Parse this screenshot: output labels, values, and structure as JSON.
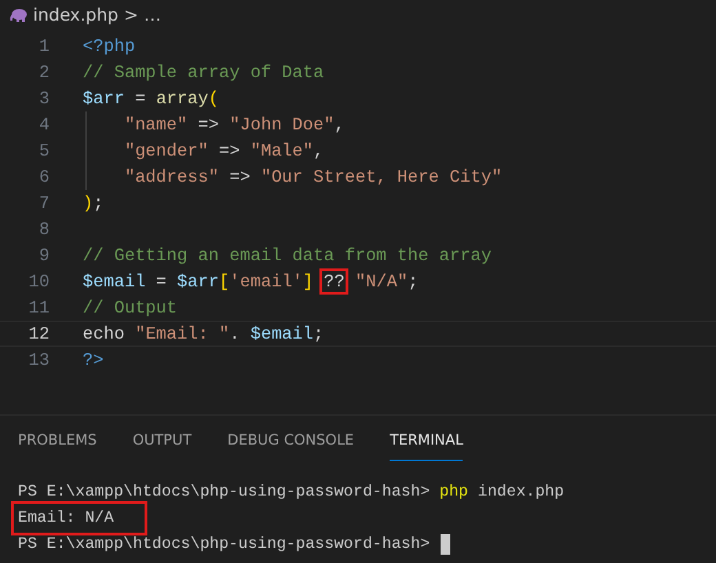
{
  "breadcrumb": {
    "items": [
      "index.php",
      "…"
    ],
    "separator": ">"
  },
  "code_lines": [
    {
      "number": "1",
      "active": false,
      "tokens": [
        {
          "kind": "keyword",
          "text": "<?php"
        }
      ]
    },
    {
      "number": "2",
      "active": false,
      "tokens": [
        {
          "kind": "comment",
          "text": "// Sample array of Data"
        }
      ]
    },
    {
      "number": "3",
      "active": false,
      "tokens": [
        {
          "kind": "variable",
          "text": "$arr"
        },
        {
          "kind": "plain",
          "text": " = "
        },
        {
          "kind": "function",
          "text": "array"
        },
        {
          "kind": "bracket",
          "text": "("
        }
      ]
    },
    {
      "number": "4",
      "active": false,
      "indented": true,
      "tokens": [
        {
          "kind": "string",
          "text": "\"name\""
        },
        {
          "kind": "plain",
          "text": " => "
        },
        {
          "kind": "string",
          "text": "\"John Doe\""
        },
        {
          "kind": "plain",
          "text": ","
        }
      ]
    },
    {
      "number": "5",
      "active": false,
      "indented": true,
      "tokens": [
        {
          "kind": "string",
          "text": "\"gender\""
        },
        {
          "kind": "plain",
          "text": " => "
        },
        {
          "kind": "string",
          "text": "\"Male\""
        },
        {
          "kind": "plain",
          "text": ","
        }
      ]
    },
    {
      "number": "6",
      "active": false,
      "indented": true,
      "tokens": [
        {
          "kind": "string",
          "text": "\"address\""
        },
        {
          "kind": "plain",
          "text": " => "
        },
        {
          "kind": "string",
          "text": "\"Our Street, Here City\""
        }
      ]
    },
    {
      "number": "7",
      "active": false,
      "tokens": [
        {
          "kind": "bracket",
          "text": ")"
        },
        {
          "kind": "plain",
          "text": ";"
        }
      ]
    },
    {
      "number": "8",
      "active": false
    },
    {
      "number": "9",
      "active": false,
      "tokens": [
        {
          "kind": "comment",
          "text": "// Getting an email data from the array"
        }
      ]
    },
    {
      "number": "10",
      "active": false,
      "tokens": [
        {
          "kind": "variable",
          "text": "$email"
        },
        {
          "kind": "plain",
          "text": " = "
        },
        {
          "kind": "variable",
          "text": "$arr"
        },
        {
          "kind": "bracket",
          "text": "["
        },
        {
          "kind": "string",
          "text": "'email'"
        },
        {
          "kind": "bracket",
          "text": "] "
        },
        {
          "kind": "plain",
          "text": "??",
          "highlighted": true
        },
        {
          "kind": "string",
          "text": " \"N/A\""
        },
        {
          "kind": "plain",
          "text": ";"
        }
      ]
    },
    {
      "number": "11",
      "active": false,
      "tokens": [
        {
          "kind": "comment",
          "text": "// Output"
        }
      ]
    },
    {
      "number": "12",
      "active": true,
      "tokens": [
        {
          "kind": "plain",
          "text": "echo "
        },
        {
          "kind": "string",
          "text": "\"Email: \""
        },
        {
          "kind": "plain",
          "text": ". "
        },
        {
          "kind": "variable",
          "text": "$email"
        },
        {
          "kind": "plain",
          "text": ";"
        }
      ]
    },
    {
      "number": "13",
      "active": false,
      "tokens": [
        {
          "kind": "keyword",
          "text": "?>"
        }
      ]
    }
  ],
  "panel_tabs": [
    {
      "label": "PROBLEMS",
      "selected": false
    },
    {
      "label": "OUTPUT",
      "selected": false
    },
    {
      "label": "DEBUG CONSOLE",
      "selected": false
    },
    {
      "label": "TERMINAL",
      "selected": true
    }
  ],
  "terminal_lines": [
    {
      "highlighted": false,
      "cursor": false,
      "segments": [
        {
          "kind": "prompt",
          "text": "PS E:\\xampp\\htdocs\\php-using-password-hash>"
        },
        {
          "kind": "command",
          "text": "php"
        },
        {
          "kind": "plain",
          "text": "index.php"
        }
      ]
    },
    {
      "highlighted": true,
      "cursor": false,
      "segments": [
        {
          "kind": "plain",
          "text": "Email: N/A"
        }
      ]
    },
    {
      "highlighted": false,
      "cursor": true,
      "segments": [
        {
          "kind": "prompt",
          "text": "PS E:\\xampp\\htdocs\\php-using-password-hash>"
        }
      ]
    }
  ]
}
